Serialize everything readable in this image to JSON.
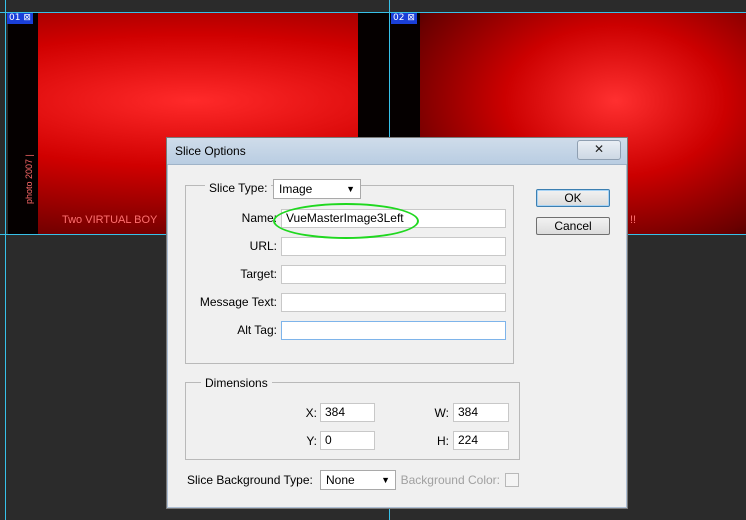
{
  "canvas": {
    "slice_badges": [
      "01",
      "02"
    ],
    "image_caption_left": "Two VIRTUAL BOY",
    "image_caption_right": "!!",
    "image_vertical_text": "photo 2007 |"
  },
  "dialog": {
    "title": "Slice Options",
    "close_label": "✕",
    "slice_type_label": "Slice Type:",
    "slice_type_value": "Image",
    "fields": {
      "name_label": "Name:",
      "name_value": "VueMasterImage3Left",
      "url_label": "URL:",
      "url_value": "",
      "target_label": "Target:",
      "target_value": "",
      "message_label": "Message Text:",
      "message_value": "",
      "alt_label": "Alt Tag:",
      "alt_value": ""
    },
    "dimensions": {
      "legend": "Dimensions",
      "x_label": "X:",
      "x_value": "384",
      "y_label": "Y:",
      "y_value": "0",
      "w_label": "W:",
      "w_value": "384",
      "h_label": "H:",
      "h_value": "224"
    },
    "background": {
      "type_label": "Slice Background Type:",
      "type_value": "None",
      "color_label": "Background Color:"
    },
    "buttons": {
      "ok": "OK",
      "cancel": "Cancel"
    }
  },
  "colors": {
    "highlight_ellipse": "#1fd81f",
    "guide": "#37c0e8",
    "slice_badge": "#1a3fd8"
  }
}
